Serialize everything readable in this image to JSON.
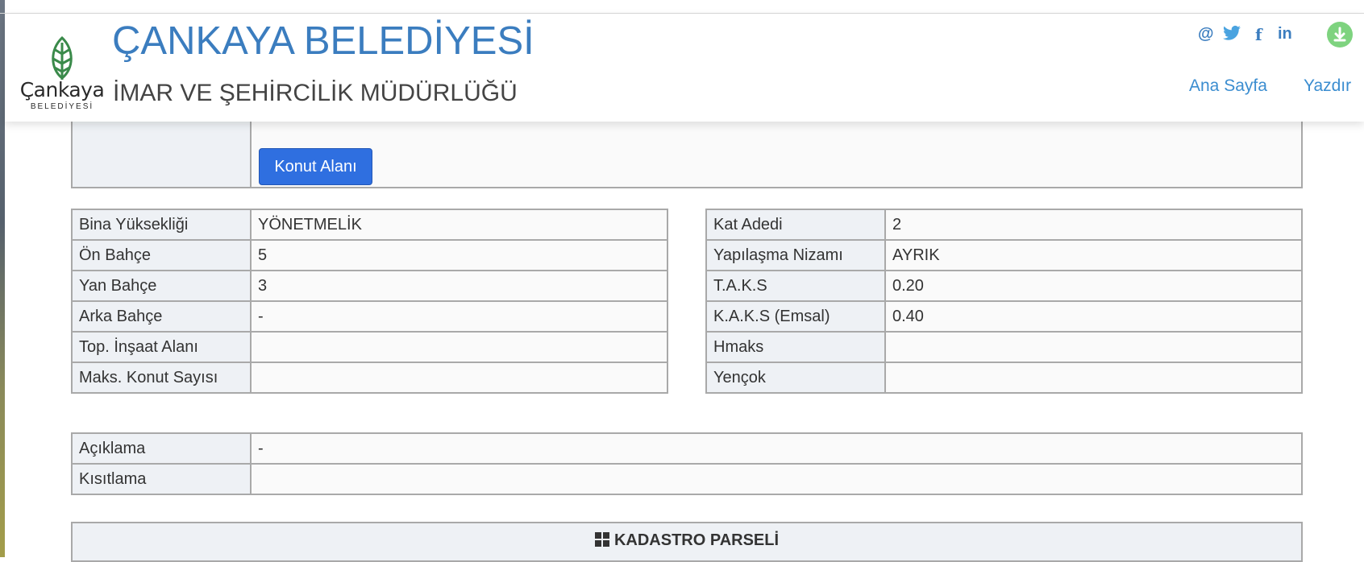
{
  "header": {
    "logo_text": "Çankaya",
    "logo_sub": "BELEDİYESİ",
    "org_title": "ÇANKAYA BELEDİYESİ",
    "dept_title": "İMAR VE ŞEHİRCİLİK MÜDÜRLÜĞÜ",
    "social": [
      {
        "icon": "at-icon",
        "glyph": "@"
      },
      {
        "icon": "twitter-icon",
        "glyph": "🐦"
      },
      {
        "icon": "facebook-icon",
        "glyph": "f"
      },
      {
        "icon": "linkedin-icon",
        "glyph": "in"
      }
    ],
    "download_icon": "download-icon",
    "nav": {
      "home": "Ana Sayfa",
      "print": "Yazdır"
    }
  },
  "usage": {
    "button_label": "Konut Alanı"
  },
  "left_table": [
    {
      "label": "Bina Yüksekliği",
      "value": "YÖNETMELİK"
    },
    {
      "label": "Ön Bahçe",
      "value": "5"
    },
    {
      "label": "Yan Bahçe",
      "value": "3"
    },
    {
      "label": "Arka Bahçe",
      "value": "-"
    },
    {
      "label": "Top. İnşaat Alanı",
      "value": ""
    },
    {
      "label": "Maks. Konut Sayısı",
      "value": ""
    }
  ],
  "right_table": [
    {
      "label": "Kat Adedi",
      "value": "2"
    },
    {
      "label": "Yapılaşma Nizamı",
      "value": "AYRIK"
    },
    {
      "label": "T.A.K.S",
      "value": "0.20"
    },
    {
      "label": "K.A.K.S (Emsal)",
      "value": "0.40"
    },
    {
      "label": "Hmaks",
      "value": ""
    },
    {
      "label": "Yençok",
      "value": ""
    }
  ],
  "notes_table": [
    {
      "label": "Açıklama",
      "value": "-"
    },
    {
      "label": "Kısıtlama",
      "value": ""
    }
  ],
  "cadastre": {
    "title": "KADASTRO PARSELİ",
    "icon": "grid-icon"
  },
  "colors": {
    "brand_blue": "#3b7dbf",
    "button_blue": "#2f6fe0",
    "download_green": "#7ed37f"
  }
}
